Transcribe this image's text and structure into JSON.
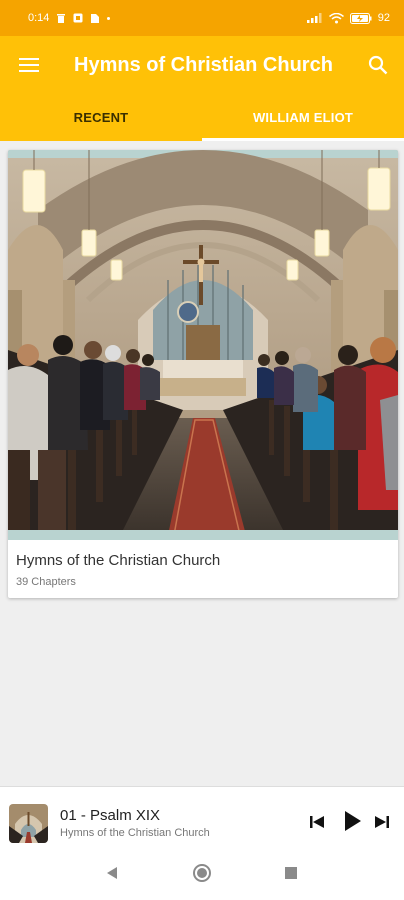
{
  "status_bar": {
    "time": "0:14",
    "battery": "92"
  },
  "app_bar": {
    "title": "Hymns of Christian Church",
    "menu_icon": "menu-icon",
    "search_icon": "search-icon"
  },
  "tabs": [
    {
      "label": "RECENT",
      "selected": false
    },
    {
      "label": "WILLIAM ELIOT",
      "selected": true
    }
  ],
  "book": {
    "title": "Hymns of the Christian Church",
    "subtitle": "39 Chapters"
  },
  "player": {
    "track_title": "01 - Psalm XIX",
    "album": "Hymns of the Christian Church"
  },
  "colors": {
    "status_bar": "#f5a400",
    "app_bar": "#ffc107",
    "tab_selected_text": "#ffffff",
    "tab_unselected_text": "#3a2f00"
  }
}
